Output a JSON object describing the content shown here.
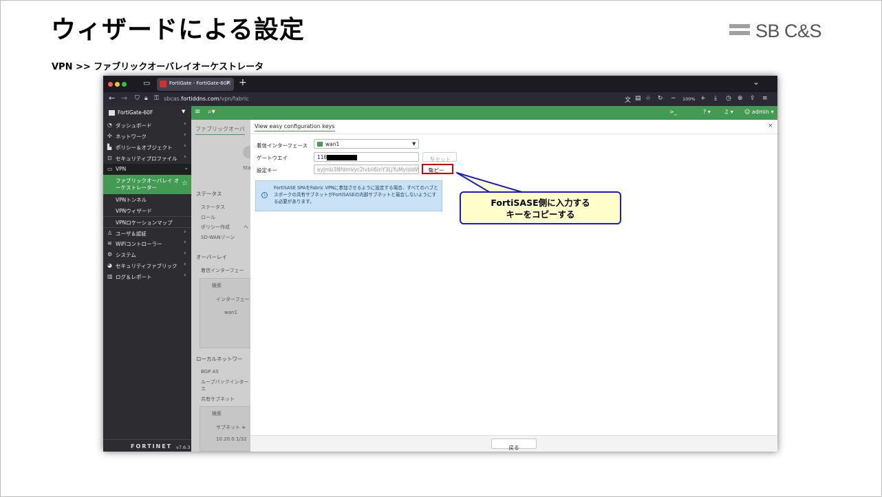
{
  "slide": {
    "title": "ウィザードによる設定",
    "subheading": "VPN >> ファブリックオーバレイオーケストレータ",
    "logo_text": "SB C&S"
  },
  "browser": {
    "tab_title": "FortiGate - FortiGate-60F",
    "url_prefix": "sbcas.",
    "url_domain": "fortiddns.com",
    "url_path": "/vpn/fabric",
    "zoom": "100%"
  },
  "fortigate": {
    "device_name": "FortiGate-60F",
    "admin_label": "admin",
    "brand": "FORTINET",
    "version": "v7.6.3"
  },
  "sidebar": {
    "items": [
      {
        "label": "ダッシュボード",
        "icon": "dashboard-icon"
      },
      {
        "label": "ネットワーク",
        "icon": "network-icon"
      },
      {
        "label": "ポリシー＆オブジェクト",
        "icon": "policy-icon"
      },
      {
        "label": "セキュリティプロファイル",
        "icon": "lock-icon"
      },
      {
        "label": "VPN",
        "icon": "laptop-icon"
      },
      {
        "label": "ファブリックオーバレイ オーケストレーター"
      },
      {
        "label": "VPNトンネル"
      },
      {
        "label": "VPNウィザード"
      },
      {
        "label": "VPNロケーションマップ"
      },
      {
        "label": "ユーザ＆認証",
        "icon": "user-icon"
      },
      {
        "label": "WiFiコントローラー",
        "icon": "wifi-icon"
      },
      {
        "label": "システム",
        "icon": "gear-icon"
      },
      {
        "label": "セキュリティファブリック",
        "icon": "fabric-icon"
      },
      {
        "label": "ログ＆レポート",
        "icon": "chart-icon"
      }
    ]
  },
  "background_page": {
    "tab": "ファブリックオーバ",
    "status_short": "Sta",
    "status_header": "ステータス",
    "status_label": "ステータス",
    "role_label": "ロール",
    "policy_label": "ポリシー作成",
    "policy_value": "へ",
    "sdwan_label": "SD-WANゾーン",
    "overlay_header": "オーバーレイ",
    "incoming_if_label": "着信インターフェー",
    "search_placeholder": "検索",
    "col_interface": "インターフェー",
    "row_wan1": "wan1",
    "local_net_header": "ローカルネットワー",
    "bgp_as": "BGP AS",
    "loopback_line1": "ループバックインター",
    "loopback_line2": "ス",
    "shared_subnet": "共有サブネット",
    "search_placeholder2": "検索",
    "col_subnet": "サブネット ≑",
    "row_subnet": "10.20.0.1/32"
  },
  "modal": {
    "title": "View easy configuration keys",
    "incoming_interface_label": "着信インターフェース",
    "incoming_interface_value": "wan1",
    "gateway_label": "ゲートウエイ",
    "gateway_value_prefix": "118",
    "config_key_label": "設定キー",
    "config_key_value": "eyJmb3NfdmVyc2lvbiI6InY3LjYuMyIsIdWk",
    "reset_label": "リセット",
    "copy_label": "コピー",
    "info_text": "FortiSASE SPAをFabric VPNに参加させるように設定する場合、すべてのハブとスポークの共有サブネットがFortiSASEの内部サブネットと競合しないようにする必要があります。",
    "back_label": "戻る"
  },
  "callout": {
    "line1": "FortiSASE側に入力する",
    "line2": "キーをコピーする"
  },
  "colors": {
    "fortigate_green": "#439a53",
    "sidebar_bg": "#2d2d31",
    "highlight_red": "#e00000",
    "callout_border": "#1a1ac8",
    "callout_fill": "#ffffcc"
  }
}
